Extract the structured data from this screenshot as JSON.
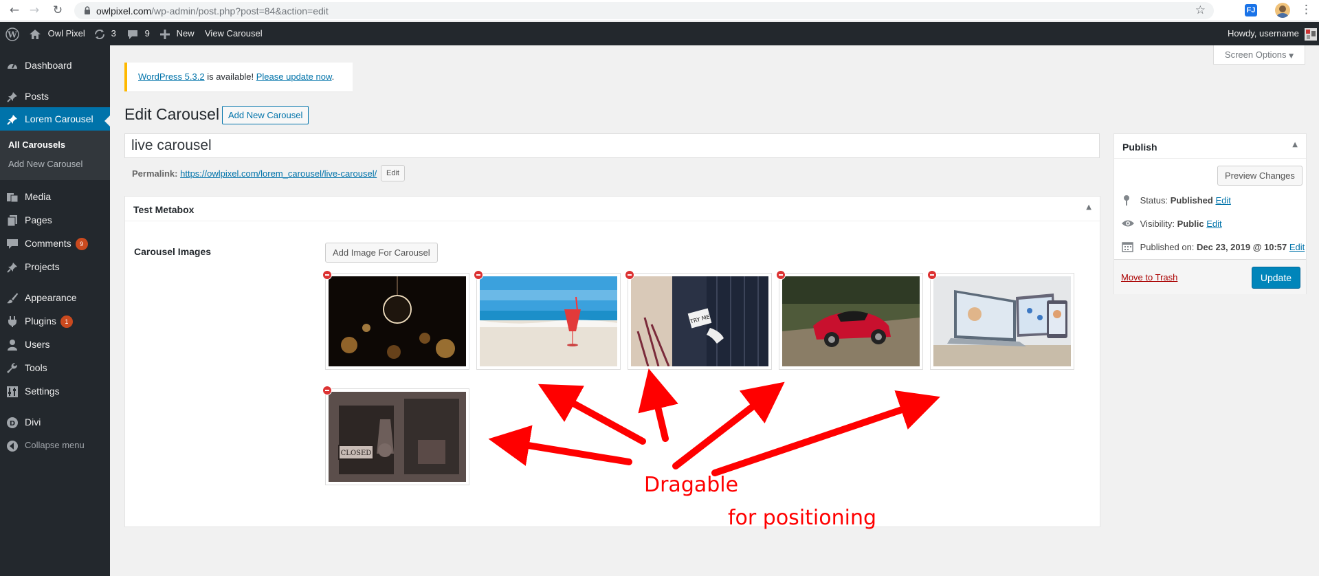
{
  "browser": {
    "url_host": "owlpixel.com",
    "url_path": "/wp-admin/post.php?post=84&action=edit",
    "extension_label": "FJ"
  },
  "admin_bar": {
    "site_name": "Owl Pixel",
    "updates_count": "3",
    "comments_count": "9",
    "new_label": "New",
    "view_label": "View Carousel",
    "howdy": "Howdy, username"
  },
  "sidebar": {
    "items": [
      {
        "label": "Dashboard",
        "icon": "dashboard-icon"
      },
      {
        "label": "Posts",
        "icon": "pin-icon"
      },
      {
        "label": "Lorem Carousel",
        "icon": "pin-icon"
      },
      {
        "label": "Media",
        "icon": "media-icon"
      },
      {
        "label": "Pages",
        "icon": "pages-icon"
      },
      {
        "label": "Comments",
        "icon": "comments-icon",
        "badge": "9"
      },
      {
        "label": "Projects",
        "icon": "pin-icon"
      },
      {
        "label": "Appearance",
        "icon": "brush-icon"
      },
      {
        "label": "Plugins",
        "icon": "plug-icon",
        "badge": "1"
      },
      {
        "label": "Users",
        "icon": "user-icon"
      },
      {
        "label": "Tools",
        "icon": "wrench-icon"
      },
      {
        "label": "Settings",
        "icon": "settings-icon"
      },
      {
        "label": "Divi",
        "icon": "divi-icon"
      },
      {
        "label": "Collapse menu",
        "icon": "collapse-icon"
      }
    ],
    "submenu": [
      "All Carousels",
      "Add New Carousel"
    ]
  },
  "screen_options": "Screen Options",
  "notice": {
    "link1": "WordPress 5.3.2",
    "middle": " is available! ",
    "link2": "Please update now",
    "end": "."
  },
  "page": {
    "title": "Edit Carousel",
    "add_new": "Add New Carousel",
    "post_title": "live carousel",
    "permalink_label": "Permalink:",
    "permalink_url": "https://owlpixel.com/lorem_carousel/live-carousel/",
    "permalink_edit": "Edit"
  },
  "metabox": {
    "title": "Test Metabox",
    "field_label": "Carousel Images",
    "add_image": "Add Image For Carousel"
  },
  "publish": {
    "title": "Publish",
    "preview": "Preview Changes",
    "status_label": "Status:",
    "status_value": "Published",
    "visibility_label": "Visibility:",
    "visibility_value": "Public",
    "published_label": "Published on:",
    "published_value": "Dec 23, 2019 @ 10:57",
    "edit": "Edit",
    "trash": "Move to Trash",
    "update": "Update"
  },
  "annotations": {
    "line1": "Dragable",
    "line2": "for positioning",
    "color": "#ff0000"
  },
  "colors": {
    "admin_dark": "#23282d",
    "accent": "#0073aa",
    "notice_warning": "#ffb900"
  }
}
